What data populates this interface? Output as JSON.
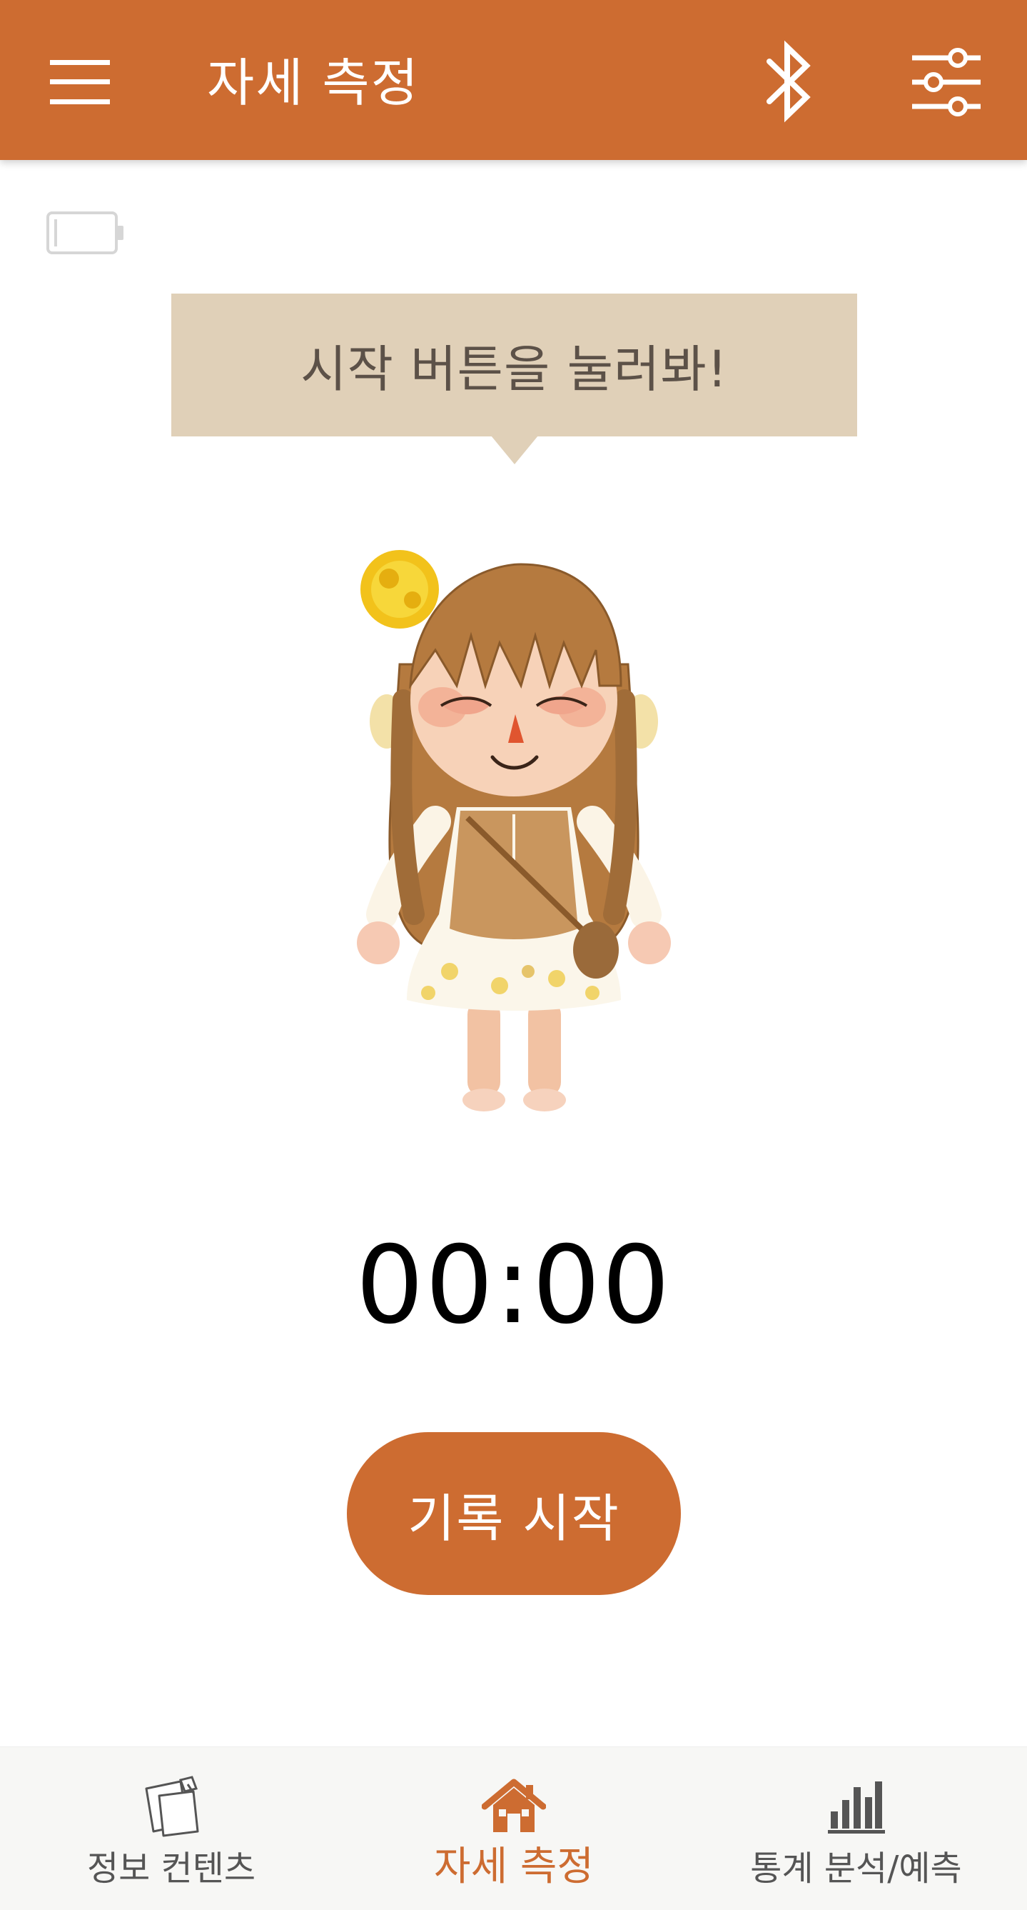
{
  "app_bar": {
    "title": "자세 측정",
    "menu_icon": "hamburger-menu-icon",
    "bluetooth_icon": "bluetooth-icon",
    "settings_icon": "sliders-icon",
    "background_color": "#cd6c31"
  },
  "status": {
    "battery_icon": "battery-empty-icon"
  },
  "bubble": {
    "text": "시작 버튼을 눌러봐!",
    "color": "#e0d0b8"
  },
  "character": {
    "icon": "avatar-character"
  },
  "timer": {
    "value": "00:00"
  },
  "record_button": {
    "label": "기록 시작",
    "color": "#cd6c31"
  },
  "bottom_nav": {
    "items": [
      {
        "label": "정보 컨텐츠",
        "icon": "notes-icon",
        "active": false
      },
      {
        "label": "자세 측정",
        "icon": "home-icon",
        "active": true
      },
      {
        "label": "통계 분석/예측",
        "icon": "bar-chart-icon",
        "active": false
      }
    ],
    "active_color": "#cd6c31"
  }
}
